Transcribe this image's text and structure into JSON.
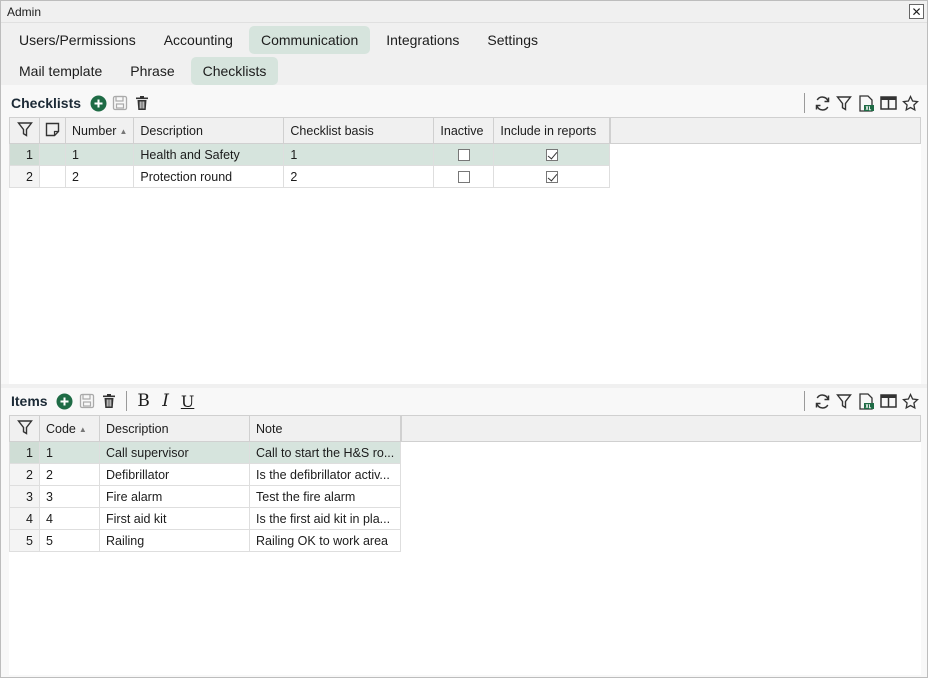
{
  "window": {
    "title": "Admin",
    "close_glyph": "✕"
  },
  "tabs_main": [
    {
      "label": "Users/Permissions",
      "active": false
    },
    {
      "label": "Accounting",
      "active": false
    },
    {
      "label": "Communication",
      "active": true
    },
    {
      "label": "Integrations",
      "active": false
    },
    {
      "label": "Settings",
      "active": false
    }
  ],
  "tabs_sub": [
    {
      "label": "Mail template",
      "active": false
    },
    {
      "label": "Phrase",
      "active": false
    },
    {
      "label": "Checklists",
      "active": true
    }
  ],
  "checklists": {
    "title": "Checklists",
    "columns": {
      "number": "Number",
      "description": "Description",
      "basis": "Checklist basis",
      "inactive": "Inactive",
      "include": "Include in reports"
    },
    "rows": [
      {
        "row": "1",
        "number": "1",
        "description": "Health and Safety",
        "basis": "1",
        "inactive": false,
        "include": true,
        "selected": true
      },
      {
        "row": "2",
        "number": "2",
        "description": "Protection round",
        "basis": "2",
        "inactive": false,
        "include": true,
        "selected": false
      }
    ]
  },
  "items": {
    "title": "Items",
    "columns": {
      "code": "Code",
      "description": "Description",
      "note": "Note"
    },
    "rows": [
      {
        "row": "1",
        "code": "1",
        "description": "Call supervisor",
        "note": "Call to start the H&S ro...",
        "selected": true
      },
      {
        "row": "2",
        "code": "2",
        "description": "Defibrillator",
        "note": "Is the defibrillator activ...",
        "selected": false
      },
      {
        "row": "3",
        "code": "3",
        "description": "Fire alarm",
        "note": "Test the fire alarm",
        "selected": false
      },
      {
        "row": "4",
        "code": "4",
        "description": "First aid kit",
        "note": "Is the first aid kit in pla...",
        "selected": false
      },
      {
        "row": "5",
        "code": "5",
        "description": "Railing",
        "note": "Railing OK to work area",
        "selected": false
      }
    ]
  },
  "formatting": {
    "bold": "B",
    "italic": "I",
    "underline": "U"
  },
  "colors": {
    "accent": "#1e6b45",
    "selected_row": "#d6e4dd",
    "active_tab": "#d6e4dd"
  }
}
